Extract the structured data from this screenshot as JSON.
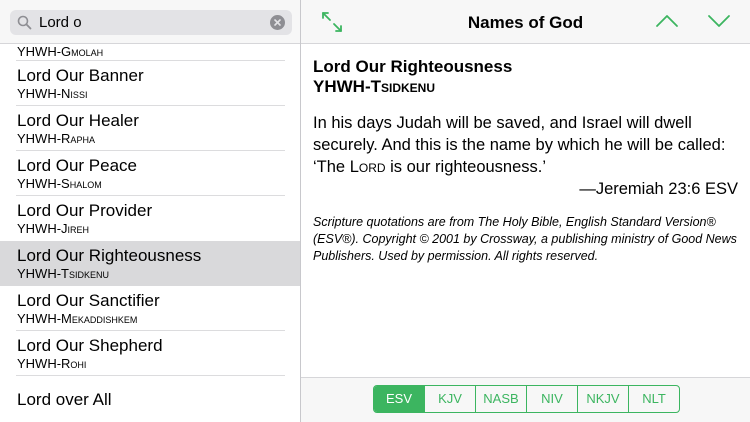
{
  "search": {
    "value": "Lord o",
    "icon": "search-icon",
    "clear_icon": "clear-icon"
  },
  "list": {
    "partial_top": {
      "hebrew": "YHWH-Gmolah"
    },
    "items": [
      {
        "name": "Lord Our Banner",
        "hebrew": "YHWH-Nissi"
      },
      {
        "name": "Lord Our Healer",
        "hebrew": "YHWH-Rapha"
      },
      {
        "name": "Lord Our Peace",
        "hebrew": "YHWH-Shalom"
      },
      {
        "name": "Lord Our Provider",
        "hebrew": "YHWH-Jireh"
      },
      {
        "name": "Lord Our Righteousness",
        "hebrew": "YHWH-Tsidkenu",
        "selected": true
      },
      {
        "name": "Lord Our Sanctifier",
        "hebrew": "YHWH-Mekaddishkem"
      },
      {
        "name": "Lord Our Shepherd",
        "hebrew": "YHWH-Rohi"
      }
    ],
    "last_item": {
      "name": "Lord over All"
    }
  },
  "nav": {
    "title": "Names of God",
    "expand_icon": "expand-icon",
    "up_icon": "chevron-up-icon",
    "down_icon": "chevron-down-icon"
  },
  "detail": {
    "title": "Lord Our Righteousness",
    "hebrew": "YHWH-Tsidkenu",
    "verse_before": "In his days Judah will be saved, and Israel will dwell securely. And this is the name by which he will be called: ‘The ",
    "verse_lord": "Lord",
    "verse_after": " is our righteousness.’",
    "reference": "—Jeremiah 23:6 ESV",
    "copyright": "Scripture quotations are from The Holy Bible, English Standard Version® (ESV®). Copyright © 2001 by Crossway, a publishing ministry of Good News Publishers. Used by permission. All rights reserved."
  },
  "versions": {
    "items": [
      {
        "label": "ESV",
        "active": true
      },
      {
        "label": "KJV"
      },
      {
        "label": "NASB"
      },
      {
        "label": "NIV"
      },
      {
        "label": "NKJV"
      },
      {
        "label": "NLT"
      }
    ]
  },
  "colors": {
    "accent": "#3cb560",
    "selected_row": "#d9d9db"
  }
}
